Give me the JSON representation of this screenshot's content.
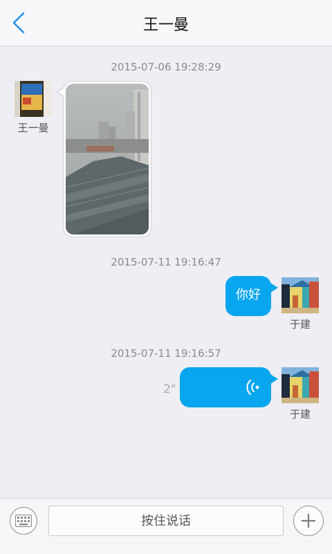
{
  "header": {
    "title": "王一曼",
    "back_icon": "chevron-left-icon",
    "accent": "#1a8ff0"
  },
  "messages": [
    {
      "timestamp": "2015-07-06 19:28:29",
      "sender": "王一曼",
      "type": "image",
      "side": "left"
    },
    {
      "timestamp": "2015-07-11 19:16:47",
      "sender": "于建",
      "type": "text",
      "text": "你好",
      "side": "right"
    },
    {
      "timestamp": "2015-07-11 19:16:57",
      "sender": "于建",
      "type": "voice",
      "duration": "2\"",
      "side": "right"
    }
  ],
  "input_bar": {
    "keyboard_icon": "keyboard-icon",
    "hold_to_talk_label": "按住说话",
    "plus_icon": "plus-icon"
  },
  "colors": {
    "bubble": "#08a6ee",
    "background": "#efeef4"
  }
}
